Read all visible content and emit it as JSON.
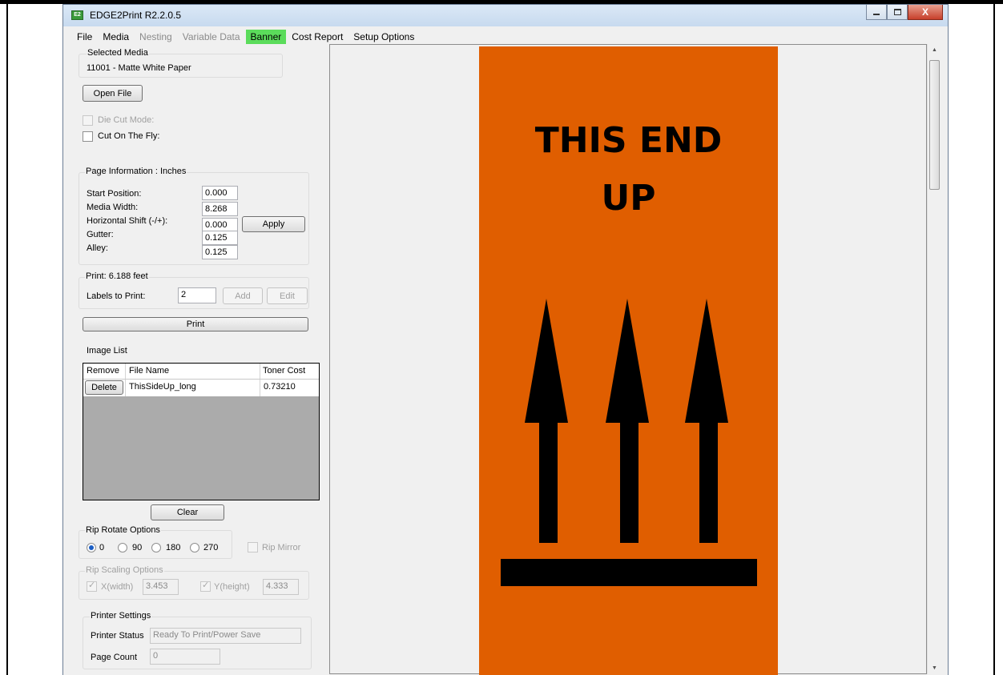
{
  "window": {
    "title": "EDGE2Print R2.2.0.5",
    "app_icon": "E2",
    "close_glyph": "X"
  },
  "menu": [
    {
      "label": "File",
      "state": "normal"
    },
    {
      "label": "Media",
      "state": "normal"
    },
    {
      "label": "Nesting",
      "state": "disabled"
    },
    {
      "label": "Variable Data",
      "state": "disabled"
    },
    {
      "label": "Banner",
      "state": "active"
    },
    {
      "label": "Cost Report",
      "state": "normal"
    },
    {
      "label": "Setup Options",
      "state": "normal"
    }
  ],
  "selected_media": {
    "group_label": "Selected Media",
    "value": "11001 - Matte White Paper"
  },
  "open_file_label": "Open File",
  "die_cut_label": "Die Cut Mode:",
  "cut_on_fly_label": "Cut On The Fly:",
  "page_info": {
    "group_label": "Page Information : Inches",
    "start_label": "Start Position:",
    "start_value": "0.000",
    "width_label": "Media Width:",
    "width_value": "8.268",
    "hshift_label": "Horizontal Shift (-/+):",
    "hshift_value": "0.000",
    "gutter_label": "Gutter:",
    "gutter_value": "0.125",
    "alley_label": "Alley:",
    "alley_value": "0.125",
    "apply_label": "Apply"
  },
  "print_group": {
    "group_label": "Print: 6.188 feet",
    "labels_label": "Labels to Print:",
    "labels_value": "2",
    "add_label": "Add",
    "edit_label": "Edit",
    "print_label": "Print"
  },
  "image_list": {
    "title": "Image List",
    "headers": {
      "remove": "Remove",
      "file_name": "File Name",
      "toner_cost": "Toner Cost"
    },
    "rows": [
      {
        "action": "Delete",
        "file_name": "ThisSideUp_long",
        "toner_cost": "0.73210"
      }
    ],
    "clear_label": "Clear"
  },
  "rip_rotate": {
    "group_label": "Rip Rotate Options",
    "options": [
      "0",
      "90",
      "180",
      "270"
    ],
    "selected": "0",
    "mirror_label": "Rip Mirror"
  },
  "rip_scaling": {
    "group_label": "Rip Scaling Options",
    "x_label": "X(width)",
    "x_value": "3.453",
    "y_label": "Y(height)",
    "y_value": "4.333"
  },
  "printer_settings": {
    "group_label": "Printer Settings",
    "status_label": "Printer Status",
    "status_value": "Ready To Print/Power Save",
    "count_label": "Page Count",
    "count_value": "0"
  },
  "preview": {
    "line1": "THIS END",
    "line2": "UP",
    "label_color": "#e05e00",
    "symbol_color": "#000000"
  }
}
